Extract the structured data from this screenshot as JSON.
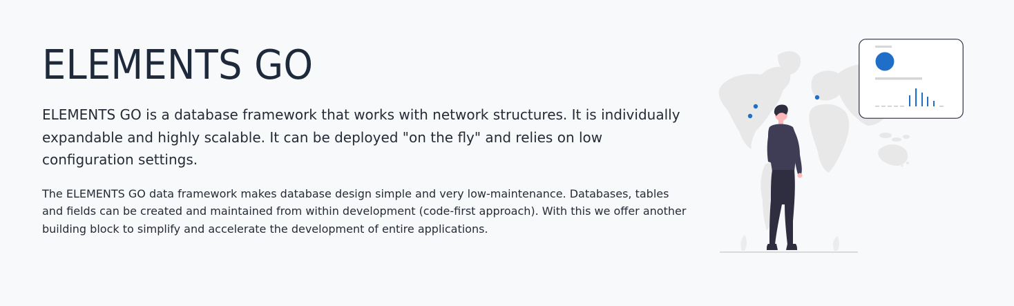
{
  "hero": {
    "title": "ELEMENTS GO",
    "lead": "ELEMENTS GO is a database framework that works with network structures. It is individually expandable and highly scalable. It can be deployed \"on the fly\" and relies on low configuration settings.",
    "body": "The ELEMENTS GO data framework makes database design simple and very low-maintenance. Databases, tables and fields can be created and maintained from within development (code-first approach). With this we offer another building block to simplify and accelerate the development of entire applications."
  },
  "illustration": {
    "icon": "person-viewing-world-map-illustration",
    "colors": {
      "accent": "#1f6fc9",
      "map": "#e8e8e8",
      "shirt": "#3f3d56",
      "pants": "#2f2e41",
      "skin": "#ffb8b8",
      "background": "#f8f9fb"
    }
  }
}
